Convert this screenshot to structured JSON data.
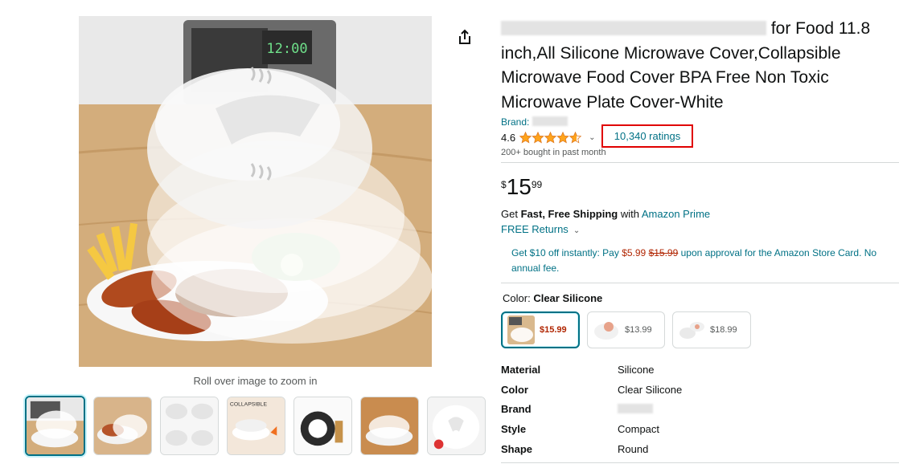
{
  "gallery": {
    "zoom_hint": "Roll over image to zoom in",
    "main_image_alt": "Collapsible silicone microwave cover over a plate of food",
    "thumbnails": [
      {
        "name": "thumb-1",
        "active": true
      },
      {
        "name": "thumb-2",
        "active": false
      },
      {
        "name": "thumb-3",
        "active": false
      },
      {
        "name": "thumb-4",
        "active": false
      },
      {
        "name": "thumb-5",
        "active": false
      },
      {
        "name": "thumb-6",
        "active": false
      },
      {
        "name": "thumb-7",
        "active": false
      }
    ],
    "microwave_display": "12:00"
  },
  "product": {
    "title_visible_start": "for Food 11.8",
    "title_rest": "inch,All Silicone Microwave Cover,Collapsible Microwave Food Cover BPA Free Non Toxic Microwave Plate Cover-White",
    "brand_prefix": "Brand:",
    "rating": "4.6",
    "rating_value": 4.6,
    "ratings_count": "10,340 ratings",
    "bought": "200+ bought in past month",
    "thumb4_caption": "COLLAPSIBLE"
  },
  "price": {
    "symbol": "$",
    "whole": "15",
    "fraction": "99"
  },
  "shipping": {
    "get": "Get",
    "fast_free": "Fast, Free Shipping",
    "with": "with",
    "prime": "Amazon Prime",
    "returns": "FREE Returns"
  },
  "promo": {
    "part1": "Get $10 off instantly: Pay",
    "new_price": "$5.99",
    "old_price": "$15.99",
    "part2": "upon approval for the Amazon Store Card. No annual fee."
  },
  "color": {
    "label": "Color:",
    "value": "Clear Silicone",
    "swatches": [
      {
        "price": "$15.99",
        "selected": true
      },
      {
        "price": "$13.99",
        "selected": false
      },
      {
        "price": "$18.99",
        "selected": false
      }
    ]
  },
  "specs": [
    {
      "key": "Material",
      "value": "Silicone"
    },
    {
      "key": "Color",
      "value": "Clear Silicone"
    },
    {
      "key": "Brand",
      "value": ""
    },
    {
      "key": "Style",
      "value": "Compact"
    },
    {
      "key": "Shape",
      "value": "Round"
    }
  ],
  "colors": {
    "link": "#007185",
    "price_red": "#b12704",
    "star": "#ffa41c",
    "highlight_box": "#e00000"
  }
}
